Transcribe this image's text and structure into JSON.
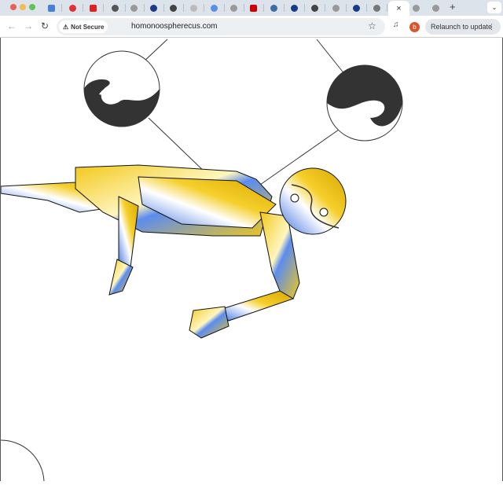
{
  "browser": {
    "tabs": [
      {
        "icon": "docs-icon",
        "color": "#4a7fd6"
      },
      {
        "icon": "bug-icon",
        "color": "#d33"
      },
      {
        "icon": "youtube-icon",
        "color": "#d22"
      },
      {
        "icon": "audio-icon",
        "color": "#555"
      },
      {
        "icon": "globe-icon",
        "color": "#999"
      },
      {
        "icon": "circle-icon",
        "color": "#1b3a8a"
      },
      {
        "icon": "chrome-icon",
        "color": "#444"
      },
      {
        "icon": "github-icon",
        "color": "#bbb"
      },
      {
        "icon": "sparkle-icon",
        "color": "#5a8de8"
      },
      {
        "icon": "globe-icon",
        "color": "#999"
      },
      {
        "icon": "netflix-icon",
        "color": "#c00"
      },
      {
        "icon": "python-icon",
        "color": "#3a6ea5"
      },
      {
        "icon": "circle-icon",
        "color": "#1b3a8a"
      },
      {
        "icon": "chrome-icon",
        "color": "#444"
      },
      {
        "icon": "globe-icon",
        "color": "#999"
      },
      {
        "icon": "circle-icon",
        "color": "#1b3a8a"
      },
      {
        "icon": "hat-icon",
        "color": "#777"
      }
    ],
    "active_tab_close": "×",
    "after_tabs": [
      {
        "icon": "globe-icon",
        "color": "#999"
      },
      {
        "icon": "globe-icon",
        "color": "#999"
      }
    ],
    "new_tab": "+",
    "security_label": "Not Secure",
    "url": "homonoospherecus.com",
    "profile_initial": "b",
    "relaunch_label": "Relaunch to update"
  },
  "page": {
    "accent_yellow": "#f2c81a",
    "accent_blue": "#3b6fe0",
    "dark": "#333333"
  }
}
